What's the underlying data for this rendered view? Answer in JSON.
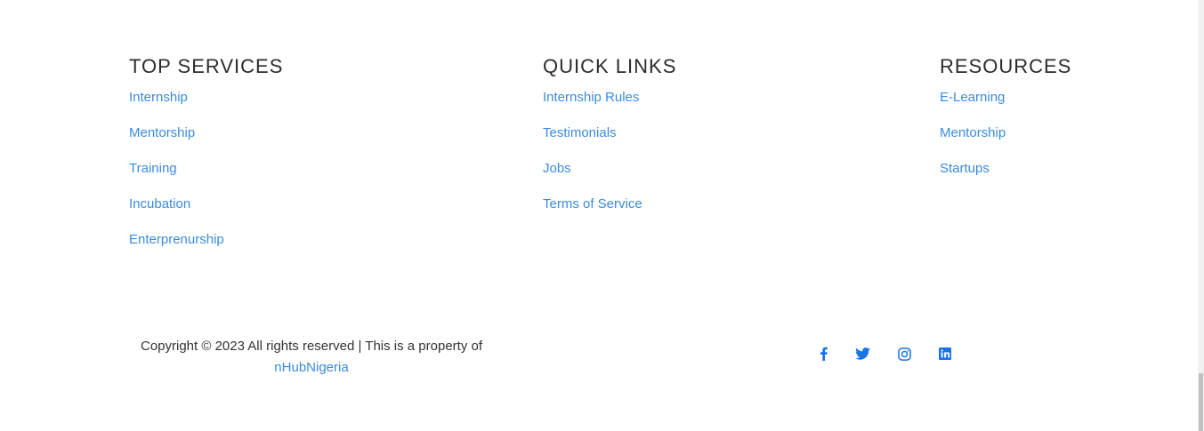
{
  "footer": {
    "columns": [
      {
        "heading": "TOP SERVICES",
        "links": [
          "Internship",
          "Mentorship",
          "Training",
          "Incubation",
          "Enterprenurship"
        ]
      },
      {
        "heading": "QUICK LINKS",
        "links": [
          "Internship Rules",
          "Testimonials",
          "Jobs",
          "Terms of Service"
        ]
      },
      {
        "heading": "RESOURCES",
        "links": [
          "E-Learning",
          "Mentorship",
          "Startups"
        ]
      }
    ],
    "copyright": {
      "text": "Copyright © 2023 All rights reserved | This is a property of",
      "owner_link": "nHubNigeria"
    },
    "social_icons": [
      "facebook-icon",
      "twitter-icon",
      "instagram-icon",
      "linkedin-icon"
    ]
  },
  "colors": {
    "link": "#3a8be0",
    "heading": "#2b2b2b",
    "icon": "#1a73e8",
    "text": "#333333"
  }
}
